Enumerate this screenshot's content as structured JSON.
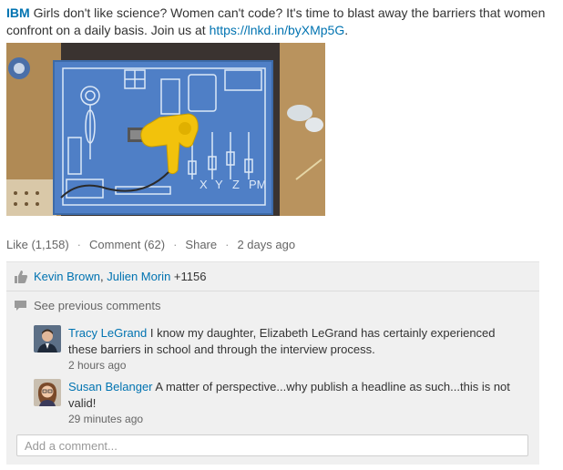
{
  "post": {
    "author": "IBM",
    "text_before_link": "Girls don't like science? Women can't code? It's time to blast away the barriers that women confront on a daily basis. Join us at ",
    "link": "https://lnkd.in/byXMp5G",
    "text_after_link": "."
  },
  "image": {
    "board_labels": [
      "X",
      "Y",
      "Z",
      "PM"
    ]
  },
  "actions": {
    "like": "Like (1,158)",
    "comment": "Comment (62)",
    "share": "Share",
    "time": "2 days ago"
  },
  "likes": {
    "name1": "Kevin Brown",
    "separator": ", ",
    "name2": "Julien Morin",
    "more": " +1156"
  },
  "see_previous": "See previous comments",
  "comments": [
    {
      "name": "Tracy LeGrand",
      "text": " I know my daughter, Elizabeth LeGrand has certainly experienced these barriers in school and through the interview process.",
      "time": "2 hours ago"
    },
    {
      "name": "Susan Belanger",
      "text": " A matter of perspective...why publish a headline as such...this is not valid!",
      "time": "29 minutes ago"
    }
  ],
  "add_comment_placeholder": "Add a comment...",
  "colors": {
    "link": "#0073b1",
    "muted": "#666666",
    "panel": "#f0f0f0"
  },
  "icons": {
    "like": "thumbs-up-icon",
    "comment": "speech-bubble-icon"
  }
}
